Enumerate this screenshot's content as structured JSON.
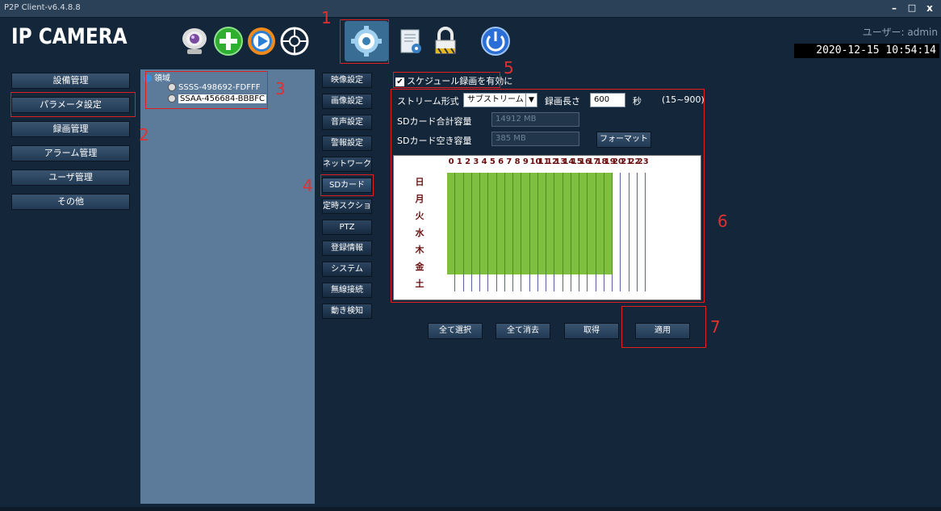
{
  "window": {
    "title": "P2P Client-v6.4.8.8",
    "minimize": "–",
    "maximize": "□",
    "close": "x"
  },
  "header": {
    "logo": "IP CAMERA",
    "user_label": "ユーザー: admin",
    "datetime": "2020-12-15 10:54:14",
    "tools": [
      "camera-icon",
      "add-icon",
      "play-icon",
      "ptz-icon",
      "settings-icon",
      "log-icon",
      "lock-icon",
      "power-icon"
    ]
  },
  "nav": [
    "設備管理",
    "パラメータ設定",
    "録画管理",
    "アラーム管理",
    "ユーザ管理",
    "その他"
  ],
  "tree": {
    "root": "領域",
    "devices": [
      "SSSS-498692-FDFFF",
      "SSAA-456684-BBBFC"
    ]
  },
  "midmenu": [
    "映像設定",
    "画像設定",
    "音声設定",
    "警報設定",
    "ネットワーク",
    "SDカード",
    "定時スクショ",
    "PTZ",
    "登録情報",
    "システム",
    "無線接続",
    "動き検知"
  ],
  "schedule": {
    "enable_label": "スケジュール録画を有効に",
    "stream_label": "ストリーム形式",
    "stream_value": "サブストリーム",
    "length_label": "録画長さ",
    "length_value": "600",
    "unit": "秒",
    "range": "(15~900)",
    "sd_total_label": "SDカード合計容量",
    "sd_total_value": "14912 MB",
    "sd_free_label": "SDカード空き容量",
    "sd_free_value": "385 MB",
    "format_button": "フォーマット",
    "hours": [
      "0",
      "1",
      "2",
      "3",
      "4",
      "5",
      "6",
      "7",
      "8",
      "9",
      "10",
      "11",
      "12",
      "13",
      "14",
      "15",
      "16",
      "17",
      "18",
      "19",
      "20",
      "21",
      "22",
      "23"
    ],
    "days": [
      "日",
      "月",
      "火",
      "水",
      "木",
      "金",
      "土"
    ],
    "recorded_until_hour": 20,
    "recorded_days": 6
  },
  "actions": {
    "select_all": "全て選択",
    "clear_all": "全て消去",
    "get": "取得",
    "apply": "適用"
  },
  "annotations": [
    "1",
    "2",
    "3",
    "4",
    "5",
    "6",
    "7"
  ],
  "colors": {
    "background": "#14273a",
    "grid_on": "#7fbf3f",
    "annotation": "#e02020"
  }
}
